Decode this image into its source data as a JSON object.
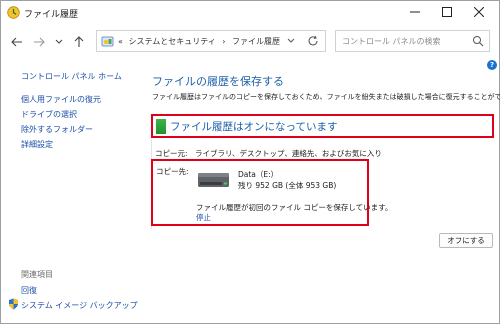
{
  "window": {
    "title": "ファイル履歴"
  },
  "nav": {
    "breadcrumb_prefix": "«",
    "breadcrumb_1": "システムとセキュリティ",
    "breadcrumb_sep": "›",
    "breadcrumb_2": "ファイル履歴",
    "search_placeholder": "コントロール パネルの検索"
  },
  "sidebar": {
    "home_link": "コントロール パネル ホーム",
    "links": [
      "個人用ファイルの復元",
      "ドライブの選択",
      "除外するフォルダー",
      "詳細設定"
    ],
    "related_heading": "関連項目",
    "related_links": [
      "回復",
      "システム イメージ バックアップ"
    ]
  },
  "main": {
    "heading": "ファイルの履歴を保存する",
    "description": "ファイル履歴はファイルのコピーを保存しておくため、ファイルを紛失または破損した場合に復元することができます",
    "status": "ファイル履歴はオンになっています",
    "copy_from_label": "コピー元:",
    "copy_from_value": "ライブラリ、デスクトップ、連絡先、およびお気に入り",
    "copy_to_label": "コピー先:",
    "drive_name": "Data（E:）",
    "drive_space": "残り 952 GB (全体 953 GB)",
    "copy_status": "ファイル履歴が初回のファイル コピーを保存しています。",
    "stop_link": "停止",
    "off_button": "オフにする"
  },
  "colors": {
    "accent_link": "#1b4ea8",
    "heading_blue": "#1b5fa8",
    "highlight_red": "#e0001a",
    "status_green": "#23912f"
  }
}
